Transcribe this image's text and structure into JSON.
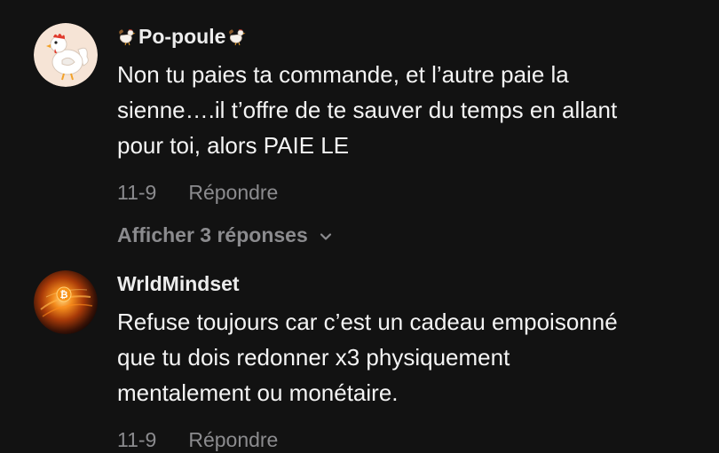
{
  "comments": [
    {
      "username": "Po-poule",
      "text": "Non tu paies ta commande, et l’autre paie la\nsienne….il t’offre de te sauver du temps en allant\npour toi, alors PAIE LE",
      "date": "11-9",
      "reply_label": "Répondre",
      "show_replies_label": "Afficher 3 réponses",
      "avatar_icon": "rooster-avatar-icon",
      "name_icons": [
        "rooster-emoji-icon",
        "rooster-emoji-icon"
      ]
    },
    {
      "username": "WrldMindset",
      "text": "Refuse toujours car c’est un cadeau empoisonné\nque tu dois redonner x3 physiquement\nmentalement ou monétaire.",
      "date": "11-9",
      "reply_label": "Répondre",
      "avatar_icon": "bitcoin-avatar-icon"
    }
  ],
  "colors": {
    "background": "#121212",
    "primary_text": "#f4f4f4",
    "secondary_text": "#8b8b8e"
  }
}
